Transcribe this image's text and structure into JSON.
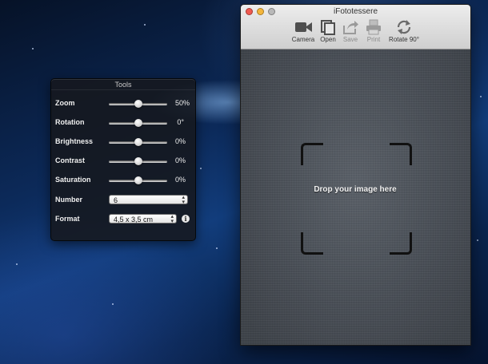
{
  "app": {
    "title": "iFototessere"
  },
  "toolbar": {
    "camera_label": "Camera",
    "open_label": "Open",
    "save_label": "Save",
    "print_label": "Print",
    "rotate_label": "Rotate 90°"
  },
  "tools": {
    "title": "Tools",
    "zoom": {
      "label": "Zoom",
      "value_text": "50%",
      "level": 0.5
    },
    "rotation": {
      "label": "Rotation",
      "value_text": "0°",
      "level": 0.5
    },
    "brightness": {
      "label": "Brightness",
      "value_text": "0%",
      "level": 0.5
    },
    "contrast": {
      "label": "Contrast",
      "value_text": "0%",
      "level": 0.5
    },
    "saturation": {
      "label": "Saturation",
      "value_text": "0%",
      "level": 0.5
    },
    "number": {
      "label": "Number",
      "value": "6"
    },
    "format": {
      "label": "Format",
      "value": "4,5 x 3,5 cm"
    }
  },
  "content": {
    "drop_text": "Drop your image here"
  },
  "icons": {
    "camera": "video-camera-icon",
    "open": "open-documents-icon",
    "save": "share-arrow-icon",
    "print": "printer-icon",
    "rotate": "rotate-arrows-icon",
    "info": "info-icon"
  },
  "colors": {
    "traffic_close": "#f05a50",
    "traffic_minimize": "#f4b63c",
    "traffic_zoom": "#b9b9b9"
  }
}
